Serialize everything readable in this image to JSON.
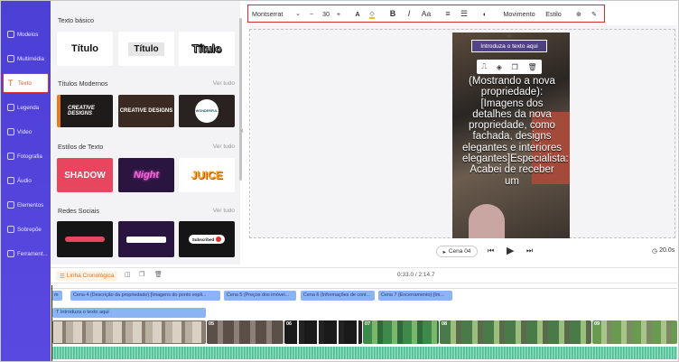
{
  "nav": {
    "items": [
      {
        "label": "Modelos",
        "icon": "templates-icon"
      },
      {
        "label": "Multimédia",
        "icon": "media-icon"
      },
      {
        "label": "Texto",
        "icon": "text-icon"
      },
      {
        "label": "Legenda",
        "icon": "subtitle-icon"
      },
      {
        "label": "Vídeo",
        "icon": "video-icon"
      },
      {
        "label": "Fotografia",
        "icon": "photo-icon"
      },
      {
        "label": "Áudio",
        "icon": "audio-icon"
      },
      {
        "label": "Elementos",
        "icon": "elements-icon"
      },
      {
        "label": "Sobrepõe",
        "icon": "overlay-icon"
      },
      {
        "label": "Ferrament...",
        "icon": "tools-icon"
      }
    ],
    "active_index": 2
  },
  "panel": {
    "basic_title": "Texto básico",
    "basic_thumbs": [
      "Título",
      "Título",
      "Título"
    ],
    "modern_title": "Títulos Modernos",
    "modern_see_all": "Ver tudo",
    "modern_thumbs": [
      "CREATIVE DESIGNS",
      "CREATIVE DESIGNS",
      "WONDERFUL"
    ],
    "styles_title": "Estilos de Texto",
    "styles_see_all": "Ver tudo",
    "style_thumbs": [
      "SHADOW",
      "Night",
      "JUICE"
    ],
    "social_title": "Redes Sociais",
    "social_see_all": "Ver tudo",
    "social_thumbs": [
      "",
      "",
      "Subscribed"
    ]
  },
  "toolbar": {
    "font": "Montserrat",
    "font_size": "30",
    "minus": "−",
    "plus": "+",
    "bold": "B",
    "italic": "I",
    "case": "Aa",
    "movement": "Movimento",
    "style": "Estilo"
  },
  "canvas": {
    "textbox_label": "Introduza o texto aqui",
    "overlay_text": "(Mostrando a nova propriedade):[Imagens dos detalhes da nova propriedade, como fachada, designs elegantes e interiores elegantes]Especialista: Acabei de receber um"
  },
  "playback": {
    "scene_label": "Cena 04",
    "duration": "20.0s"
  },
  "timeline": {
    "tab_label": "Linha Cronológica",
    "time": "0:33.0 / 2:14.7",
    "clips": [
      {
        "label": "m"
      },
      {
        "label": "Cena 4 (Descrição da propriedade):[Imagens do ponto expli..."
      },
      {
        "label": "Cena 5 (Preços dos imóvei..."
      },
      {
        "label": "Cena 6 (Informações de cont..."
      },
      {
        "label": "Cena 7 (Encerramento):[Im..."
      }
    ],
    "text_track": "Introduza o texto aqui",
    "scenes": [
      "",
      "05",
      "06",
      "07",
      "08",
      "09"
    ]
  }
}
